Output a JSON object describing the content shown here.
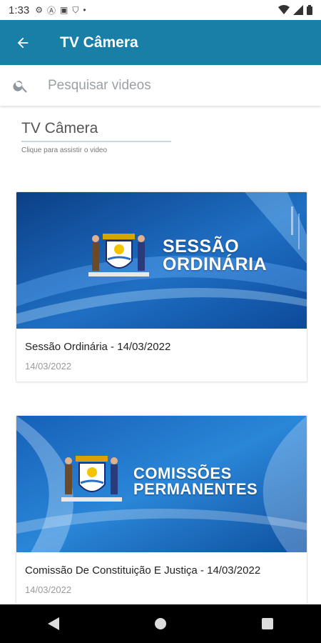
{
  "status_bar": {
    "time": "1:33"
  },
  "app_bar": {
    "title": "TV Câmera"
  },
  "search": {
    "placeholder": "Pesquisar videos"
  },
  "section": {
    "title": "TV Câmera",
    "hint": "Clique para assistir o video"
  },
  "videos": [
    {
      "thumbnail_line1": "SESSÃO",
      "thumbnail_line2": "ORDINÁRIA",
      "title": "Sessão Ordinária - 14/03/2022",
      "date": "14/03/2022"
    },
    {
      "thumbnail_line1": "COMISSÕES",
      "thumbnail_line2": "PERMANENTES",
      "title": "Comissão De Constituição E Justiça - 14/03/2022",
      "date": "14/03/2022"
    }
  ],
  "colors": {
    "primary": "#1a7fa6",
    "thumb_blue": "#1f6fc4"
  },
  "icons": [
    "back-arrow-icon",
    "search-icon",
    "nav-back-icon",
    "nav-home-icon",
    "nav-recents-icon"
  ]
}
